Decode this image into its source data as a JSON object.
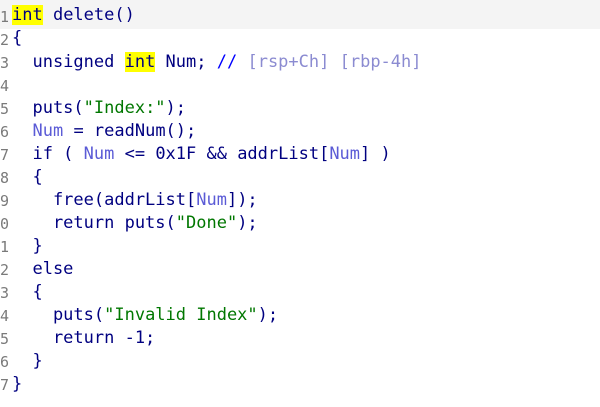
{
  "gutter": [
    "1",
    "2",
    "3",
    "4",
    "5",
    "6",
    "7",
    "8",
    "9",
    "0",
    "1",
    "2",
    "3",
    "4",
    "5",
    "6",
    "7"
  ],
  "code": {
    "line1": {
      "kw": "int",
      "rest": " delete()"
    },
    "line2": {
      "text": "{"
    },
    "line3": {
      "pre": "  unsigned ",
      "kw": "int",
      "mid": " Num; ",
      "comment": "//",
      "reg1": "[rsp+Ch]",
      "reg2": "[rbp-4h]"
    },
    "line5": {
      "pre": "  puts(",
      "str": "\"Index:\"",
      "post": ");"
    },
    "line6": {
      "pre": "  ",
      "var": "Num",
      "post": " = readNum();"
    },
    "line7": {
      "pre": "  if ( ",
      "var1": "Num",
      "mid1": " <= 0x1F && addrList[",
      "var2": "Num",
      "post": "] )"
    },
    "line8": {
      "text": "  {"
    },
    "line9": {
      "pre": "    free(addrList[",
      "var": "Num",
      "post": "]);"
    },
    "line10": {
      "pre": "    return puts(",
      "str": "\"Done\"",
      "post": ");"
    },
    "line11": {
      "text": "  }"
    },
    "line12": {
      "text": "  else"
    },
    "line13": {
      "text": "  {"
    },
    "line14": {
      "pre": "    puts(",
      "str": "\"Invalid Index\"",
      "post": ");"
    },
    "line15": {
      "text": "    return -1;"
    },
    "line16": {
      "text": "  }"
    },
    "line17": {
      "text": "}"
    }
  }
}
